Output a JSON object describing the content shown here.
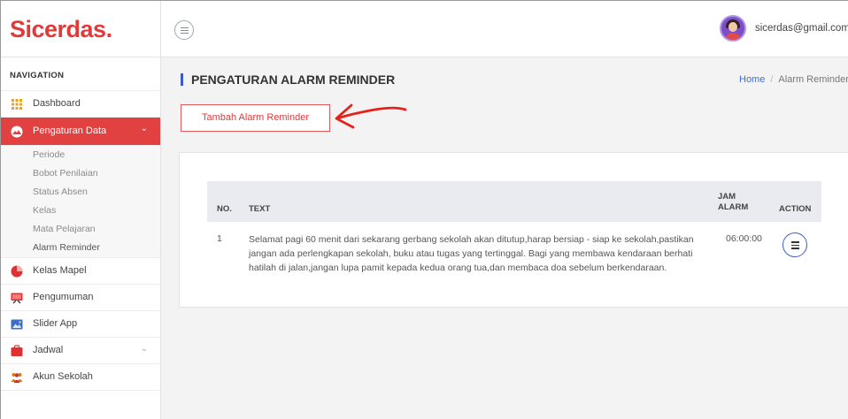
{
  "app": {
    "logo": "Sicerdas."
  },
  "header": {
    "user_email": "sicerdas@gmail.com"
  },
  "sidebar": {
    "heading": "NAVIGATION",
    "items": [
      {
        "label": "Dashboard",
        "icon": "dashboard-grid-icon"
      },
      {
        "label": "Pengaturan Data",
        "icon": "data-settings-icon",
        "active": true,
        "expandable": true,
        "children": [
          "Periode",
          "Bobot Penilaian",
          "Status Absen",
          "Kelas",
          "Mata Pelajaran",
          "Alarm Reminder"
        ]
      },
      {
        "label": "Kelas Mapel",
        "icon": "class-subject-icon"
      },
      {
        "label": "Pengumuman",
        "icon": "announcement-icon"
      },
      {
        "label": "Slider App",
        "icon": "slider-image-icon"
      },
      {
        "label": "Jadwal",
        "icon": "schedule-icon",
        "expandable": true
      },
      {
        "label": "Akun Sekolah",
        "icon": "school-account-icon"
      }
    ],
    "chevron": "⌄"
  },
  "page": {
    "title": "PENGATURAN ALARM REMINDER",
    "breadcrumb": {
      "home": "Home",
      "separator": "/",
      "current": "Alarm Reminder"
    },
    "add_button": "Tambah Alarm Reminder"
  },
  "table": {
    "headers": {
      "no": "NO.",
      "text": "TEXT",
      "jam_line1": "JAM",
      "jam_line2": "ALARM",
      "action": "ACTION"
    },
    "rows": [
      {
        "no": "1",
        "text": "Selamat pagi 60 menit dari sekarang gerbang sekolah akan ditutup,harap bersiap - siap ke sekolah,pastikan jangan ada perlengkapan sekolah, buku atau tugas yang tertinggal. Bagi yang membawa kendaraan berhati hatilah di jalan,jangan lupa pamit kepada kedua orang tua,dan membaca doa sebelum berkendaraan.",
        "jam_alarm": "06:00:00"
      }
    ]
  },
  "colors": {
    "brand": "#e03a3a",
    "accent_blue": "#3b5cc4",
    "annotation_arrow": "#e8201c"
  }
}
